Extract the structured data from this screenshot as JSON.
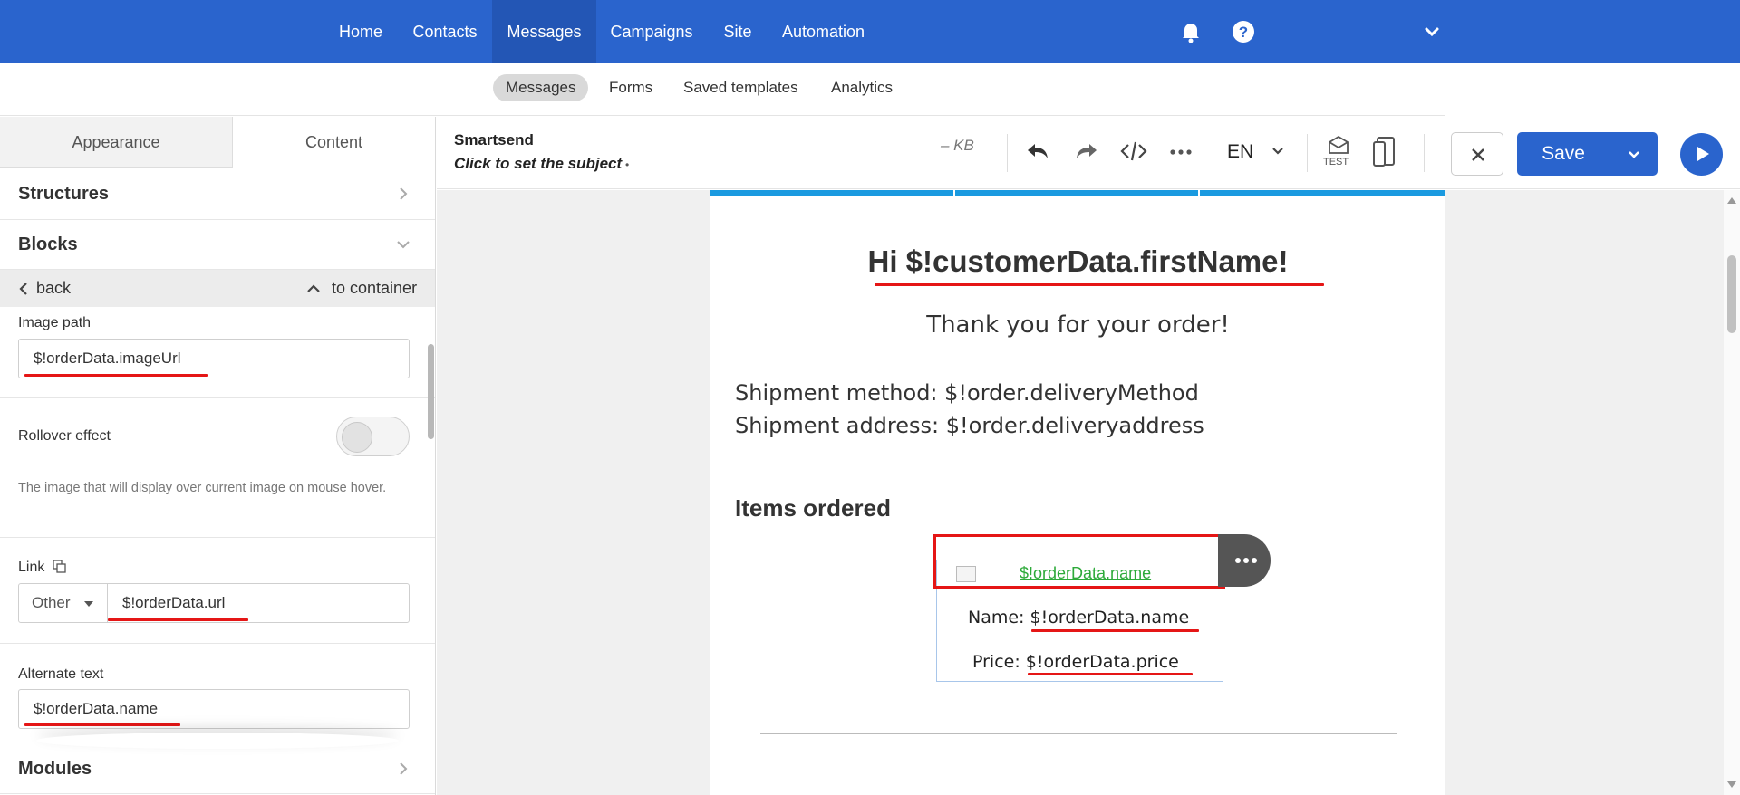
{
  "topnav": {
    "items": [
      {
        "label": "Home"
      },
      {
        "label": "Contacts"
      },
      {
        "label": "Messages",
        "active": true
      },
      {
        "label": "Campaigns"
      },
      {
        "label": "Site"
      },
      {
        "label": "Automation"
      }
    ],
    "icons": [
      "bell-icon",
      "help-icon",
      "chevron-down-icon"
    ]
  },
  "subnav": {
    "items": [
      {
        "label": "Messages",
        "active": true
      },
      {
        "label": "Forms"
      },
      {
        "label": "Saved templates"
      },
      {
        "label": "Analytics"
      }
    ]
  },
  "leftpanel": {
    "tabs": [
      {
        "label": "Appearance"
      },
      {
        "label": "Content",
        "active": true
      }
    ],
    "structures_label": "Structures",
    "blocks_label": "Blocks",
    "back_label": "back",
    "to_container_label": "to container",
    "image_path": {
      "label": "Image path",
      "value": "$!orderData.imageUrl"
    },
    "rollover": {
      "label": "Rollover effect",
      "enabled": false,
      "help": "The image that will display over current image on mouse hover."
    },
    "link": {
      "label": "Link",
      "type": "Other",
      "value": "$!orderData.url"
    },
    "alt_text": {
      "label": "Alternate text",
      "value": "$!orderData.name"
    },
    "modules_label": "Modules"
  },
  "editor": {
    "title": "Smartsend",
    "subject": "Click to set the subject",
    "dot": "•",
    "size": "– KB",
    "language": "EN",
    "test_label": "TEST",
    "save_label": "Save"
  },
  "email": {
    "greeting": "Hi $!customerData.firstName!",
    "thanks": "Thank you for your order!",
    "shipment_method": "Shipment method: $!order.deliveryMethod",
    "shipment_address": "Shipment address: $!order.deliveryaddress",
    "items_heading": "Items ordered",
    "product_link": "$!orderData.name",
    "name_label": "Name: ",
    "name_value": "$!orderData.name",
    "price_label": "Price: ",
    "price_value": "$!orderData.price"
  },
  "colors": {
    "brand": "#2a64cd",
    "accent_bar": "#1a9ae0",
    "annotation": "#e51616",
    "link": "#2eaa3a"
  }
}
